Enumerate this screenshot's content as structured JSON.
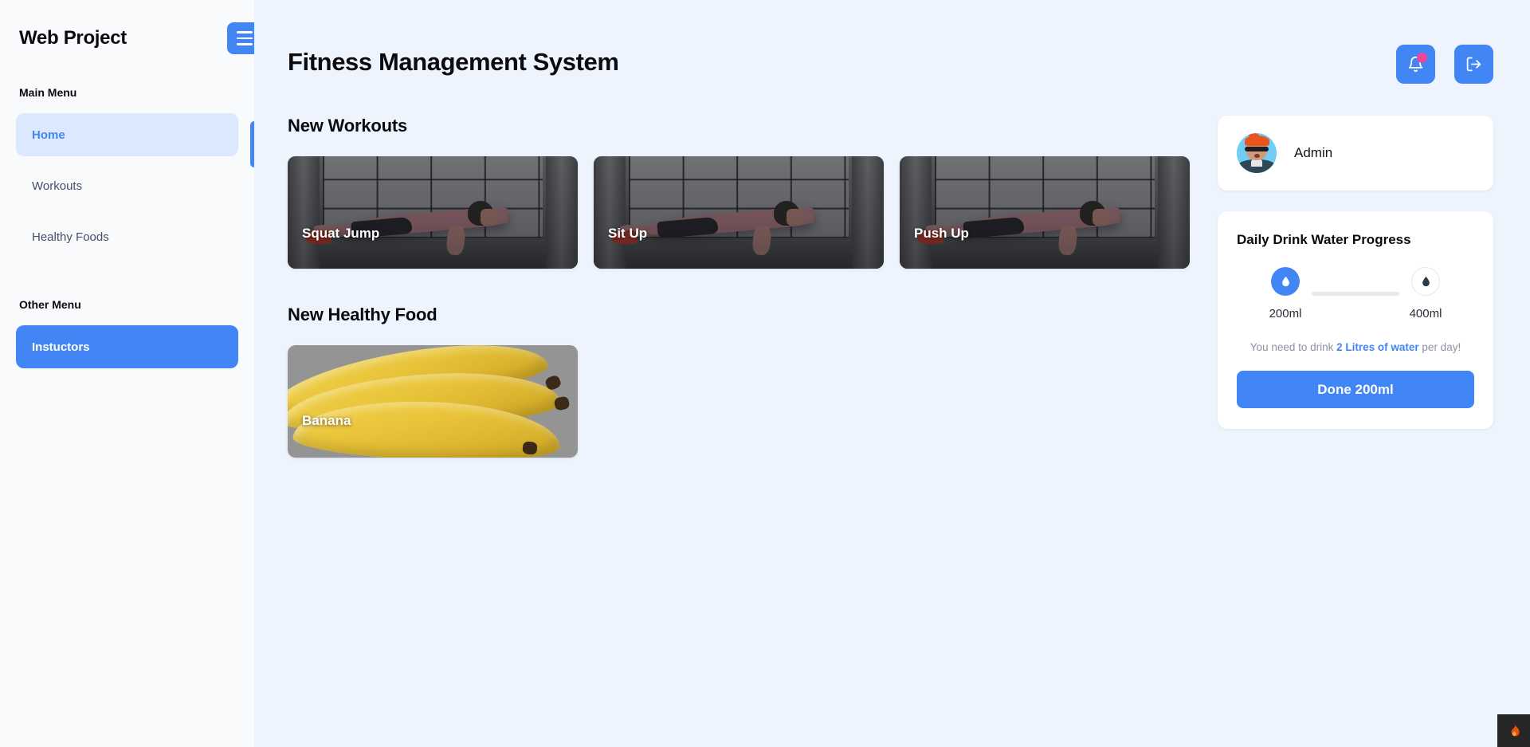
{
  "sidebar": {
    "brand": "Web Project",
    "menu_button_icon": "hamburger-icon",
    "main_menu_caption": "Main Menu",
    "other_menu_caption": "Other Menu",
    "main_items": [
      {
        "label": "Home",
        "active": true
      },
      {
        "label": "Workouts",
        "active": false
      },
      {
        "label": "Healthy Foods",
        "active": false
      }
    ],
    "other_items": [
      {
        "label": "Instuctors",
        "active": true
      }
    ]
  },
  "header": {
    "title": "Fitness Management System",
    "notifications_icon": "bell-icon",
    "has_notification_dot": true,
    "logout_icon": "logout-icon"
  },
  "main": {
    "workouts_title": "New Workouts",
    "workouts": [
      {
        "label": "Squat Jump"
      },
      {
        "label": "Sit Up"
      },
      {
        "label": "Push Up"
      }
    ],
    "foods_title": "New Healthy Food",
    "foods": [
      {
        "label": "Banana"
      }
    ]
  },
  "right_panel": {
    "profile": {
      "name": "Admin",
      "avatar_icon": "avatar"
    },
    "water": {
      "title": "Daily Drink Water Progress",
      "steps": [
        {
          "label": "200ml",
          "filled": true,
          "icon": "water-drop-icon"
        },
        {
          "label": "400ml",
          "filled": false,
          "icon": "water-drop-icon"
        }
      ],
      "note_prefix": "You need to drink ",
      "note_highlight": "2 Litres of water",
      "note_suffix": " per day!",
      "done_label": "Done 200ml"
    }
  },
  "corner_badge": {
    "icon": "flame-icon"
  },
  "colors": {
    "accent": "#4285f4",
    "accent_soft": "#dbe8fd",
    "main_bg": "#eef4fe",
    "sidebar_bg": "#f8fafc",
    "notification_dot": "#ec4899",
    "card_bg": "#ffffff",
    "muted_text": "#8b92a1"
  }
}
